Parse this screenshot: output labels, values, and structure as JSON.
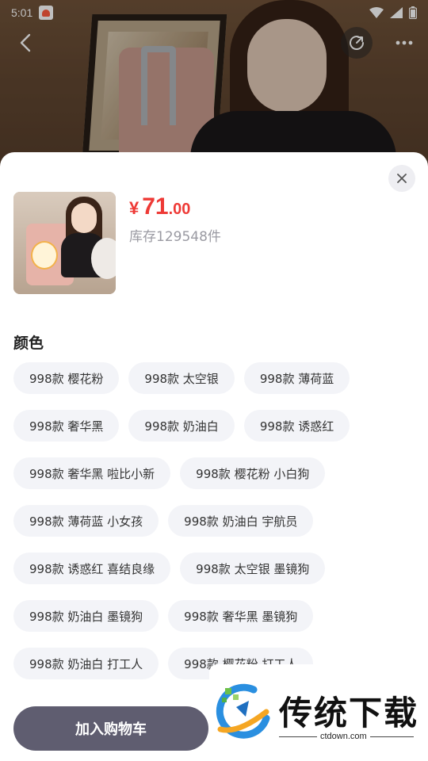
{
  "status_bar": {
    "time": "5:01"
  },
  "product": {
    "price_symbol": "¥",
    "price_integer": "71",
    "price_decimal": ".00",
    "stock_text": "库存129548件"
  },
  "color_section": {
    "title": "颜色",
    "options": [
      "998款 樱花粉",
      "998款 太空银",
      "998款 薄荷蓝",
      "998款 奢华黑",
      "998款 奶油白",
      "998款 诱惑红",
      "998款 奢华黑 啦比小新",
      "998款 樱花粉 小白狗",
      "998款 薄荷蓝 小女孩",
      "998款 奶油白 宇航员",
      "998款 诱惑红 喜结良缘",
      "998款 太空银 墨镜狗",
      "998款 奶油白 墨镜狗",
      "998款 奢华黑 墨镜狗",
      "998款 奶油白 打工人",
      "998款 樱花粉 打工人"
    ]
  },
  "actions": {
    "add_to_cart": "加入购物车"
  },
  "watermark": {
    "brand": "传统下载",
    "url": "ctdown.com"
  },
  "icons": {
    "back": "chevron-left-icon",
    "share": "share-icon",
    "more": "more-icon",
    "close": "close-icon"
  },
  "colors": {
    "price_red": "#ee3a36",
    "cart_button": "#5f5d70",
    "chip_bg": "#f3f4f8"
  }
}
